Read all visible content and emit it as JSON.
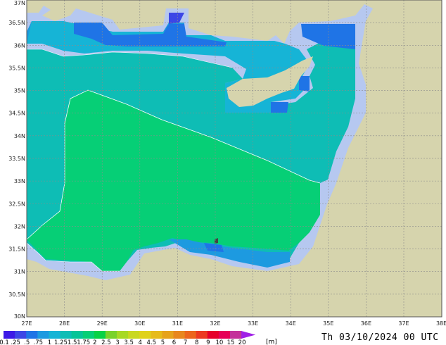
{
  "map": {
    "lon_labels": [
      "27E",
      "28E",
      "29E",
      "30E",
      "31E",
      "32E",
      "33E",
      "34E",
      "35E",
      "36E",
      "37E",
      "38E"
    ],
    "lat_labels": [
      "37N",
      "36.5N",
      "36N",
      "35.5N",
      "35N",
      "34.5N",
      "34N",
      "33.5N",
      "33N",
      "32.5N",
      "32N",
      "31.5N",
      "31N",
      "30.5N",
      "30N"
    ],
    "colors": {
      "land": "#d6d4ad",
      "coast_halo": "#b6c8f0",
      "grid": "#8c8c8c",
      "contour": "#ffffff"
    }
  },
  "legend": {
    "labels": [
      "0.1",
      ".25",
      ".5",
      ".75",
      "1",
      "1.25",
      "1.5",
      "1.75",
      "2",
      "2.5",
      "3",
      "3.5",
      "4",
      "4.5",
      "5",
      "6",
      "7",
      "8",
      "9",
      "10",
      "15",
      "20"
    ],
    "colors": [
      "#3c19e6",
      "#3c46e6",
      "#1f74e6",
      "#1d9ae0",
      "#16b4d6",
      "#0ebdb5",
      "#06c498",
      "#06cf76",
      "#08d245",
      "#79d22a",
      "#a7d924",
      "#c9d820",
      "#e0d21a",
      "#e6bb1a",
      "#e6a31c",
      "#e8871d",
      "#ec661d",
      "#ec3a22",
      "#e6002b",
      "#e60056",
      "#c4329a",
      "#a01fe6"
    ],
    "unit": "[m]"
  },
  "timestamp": "Th 03/10/2024 00 UTC"
}
